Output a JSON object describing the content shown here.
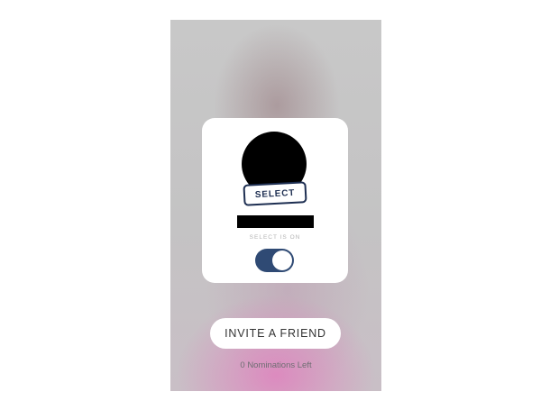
{
  "card": {
    "select_tag_label": "SELECT",
    "select_status": "SELECT IS ON",
    "toggle_on": true
  },
  "invite_button_label": "INVITE A FRIEND",
  "nominations_left": "0 Nominations Left",
  "colors": {
    "accent": "#2f4a74",
    "tag_border": "#1e2f52"
  }
}
